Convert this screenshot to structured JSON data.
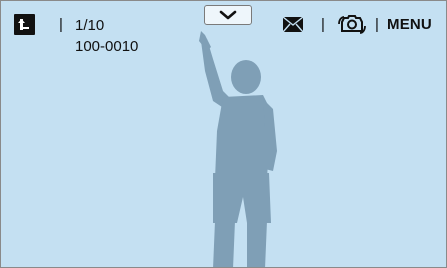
{
  "viewer": {
    "counter": "1/10",
    "folder_file": "100-0010",
    "separator": "|",
    "menu_label": "MENU"
  },
  "icons": {
    "back": "return-icon",
    "dropdown": "chevron-down-icon",
    "message": "envelope-icon",
    "edit": "photo-edit-icon"
  },
  "colors": {
    "background": "#c4e0f2",
    "silhouette": "#7f9fb6",
    "text": "#111111"
  }
}
